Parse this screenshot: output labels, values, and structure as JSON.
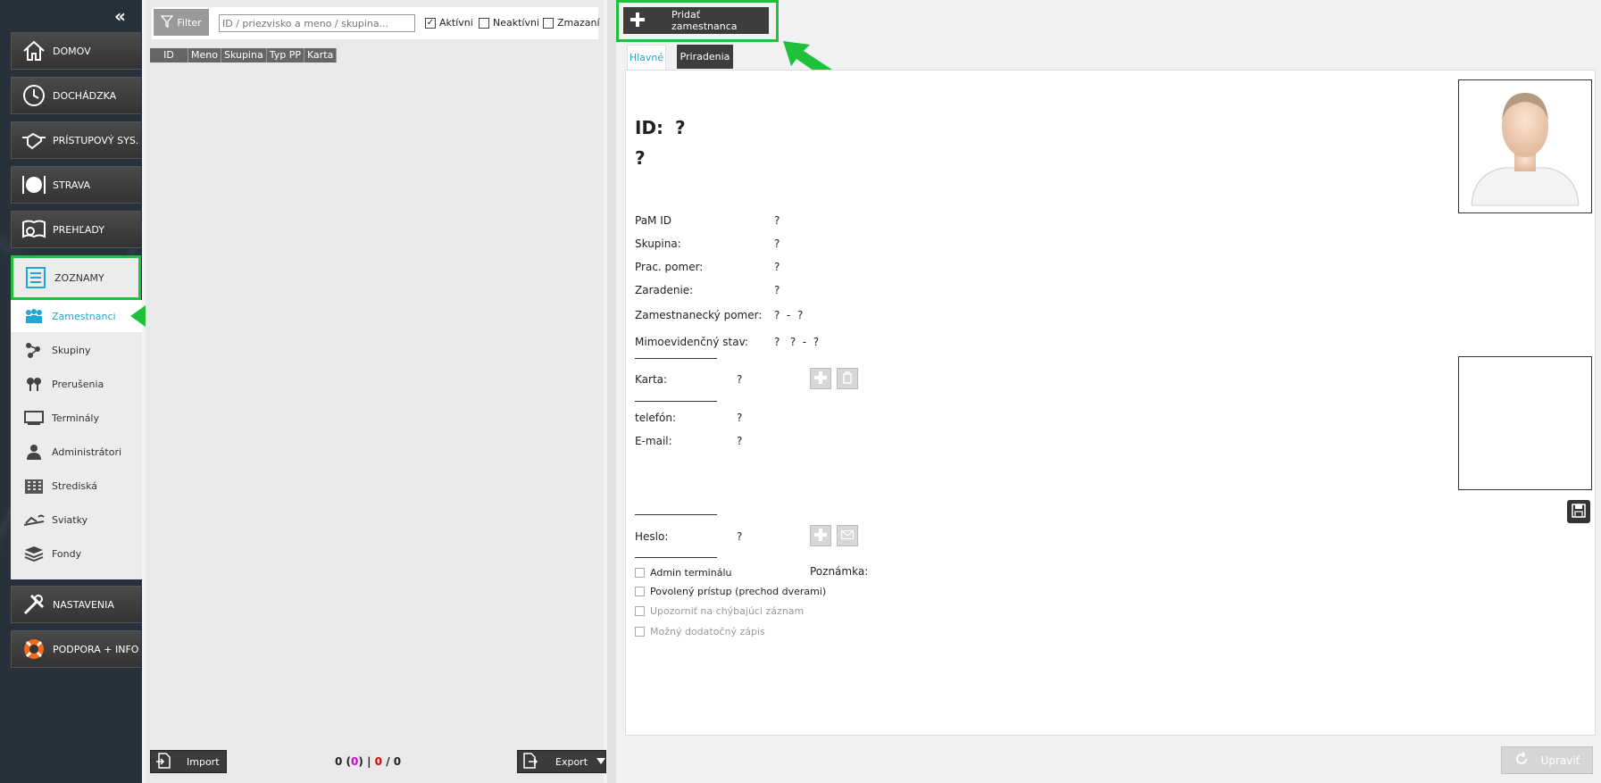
{
  "nav": {
    "collapse": "«",
    "items": [
      {
        "label": "DOMOV",
        "icon": "home-icon"
      },
      {
        "label": "DOCHÁDZKA",
        "icon": "clock-icon"
      },
      {
        "label": "PRÍSTUPOVÝ SYS.",
        "icon": "handshake-icon"
      },
      {
        "label": "STRAVA",
        "icon": "plate-icon"
      },
      {
        "label": "PREHĽADY",
        "icon": "book-search-icon"
      },
      {
        "label": "ZOZNAMY",
        "icon": "list-icon"
      },
      {
        "label": "NASTAVENIA",
        "icon": "tools-icon"
      },
      {
        "label": "PODPORA + INFO",
        "icon": "lifebuoy-icon"
      }
    ],
    "sub_items": [
      {
        "label": "Zamestnanci",
        "icon": "people-icon"
      },
      {
        "label": "Skupiny",
        "icon": "group-icon"
      },
      {
        "label": "Prerušenia",
        "icon": "pins-icon"
      },
      {
        "label": "Terminály",
        "icon": "terminal-icon"
      },
      {
        "label": "Administrátori",
        "icon": "admin-icon"
      },
      {
        "label": "Strediská",
        "icon": "building-icon"
      },
      {
        "label": "Sviatky",
        "icon": "holiday-icon"
      },
      {
        "label": "Fondy",
        "icon": "layers-icon"
      }
    ]
  },
  "filter": {
    "button_label": "Filter",
    "placeholder": "ID / priezvisko a meno / skupina...",
    "active_label": "Aktívni",
    "inactive_label": "Neaktívni",
    "deleted_label": "Zmazaní",
    "active_checked": "✓"
  },
  "grid": {
    "columns": [
      "ID",
      "Meno",
      "Skupina",
      "Typ PP",
      "Karta"
    ]
  },
  "bottom": {
    "import_label": "Import",
    "export_label": "Export",
    "count_a": "0",
    "count_b": "0",
    "count_c": "0",
    "count_d": "0",
    "sep1": "(",
    "sep2": ")",
    "sep3": "|",
    "sep4": "/"
  },
  "toolbar": {
    "add_employee_label": "Pridať zamestnanca"
  },
  "tabs": {
    "main": "Hlavné",
    "assignments": "Priradenia"
  },
  "detail": {
    "id_label": "ID:",
    "id_value": "?",
    "name_value": "?",
    "pam_id_label": "PaM ID",
    "pam_id_value": "?",
    "group_label": "Skupina:",
    "group_value": "?",
    "work_ratio_label": "Prac. pomer:",
    "work_ratio_value": "?",
    "classification_label": "Zaradenie:",
    "classification_value": "?",
    "employment_label": "Zamestnanecký pomer:",
    "employment_value": "?  -  ?",
    "extra_status_label": "Mimoevidenčný stav:",
    "extra_status_value": "?   ?  -  ?",
    "card_label": "Karta:",
    "card_value": "?",
    "phone_label": "telefón:",
    "phone_value": "?",
    "email_label": "E-mail:",
    "email_value": "?",
    "password_label": "Heslo:",
    "password_value": "?",
    "note_label": "Poznámka:",
    "checkboxes": [
      "Admin terminálu",
      "Povolený prístup (prechod dverami)",
      "Upozorniť na chýbajúci záznam",
      "Možný dodatočný zápis"
    ],
    "update_label": "Upraviť"
  },
  "colors": {
    "highlight_green": "#1ec13b",
    "accent_blue": "#1ba8d6",
    "count_magenta": "#d400d4",
    "count_red": "#e00000"
  }
}
